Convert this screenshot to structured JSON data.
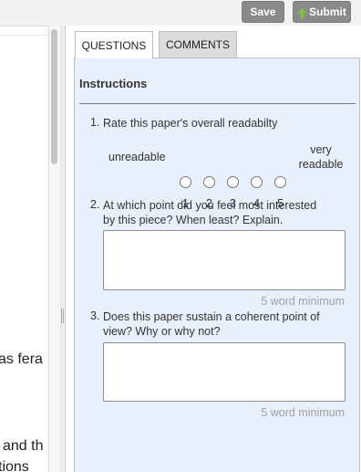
{
  "toolbar": {
    "save_label": "Save",
    "submit_label": "Submit"
  },
  "document": {
    "fragments": [
      "as fera",
      "and th",
      "tions"
    ]
  },
  "tabs": [
    {
      "label": "QUESTIONS",
      "active": true
    },
    {
      "label": "COMMENTS",
      "active": false
    }
  ],
  "instructions": {
    "title": "Instructions"
  },
  "questions": [
    {
      "number": "1.",
      "text": "Rate this paper's overall readabilty",
      "scale": {
        "low_label": "unreadable",
        "high_label_line1": "very",
        "high_label_line2": "readable",
        "options": [
          "1",
          "2",
          "3",
          "4",
          "5"
        ]
      }
    },
    {
      "number": "2.",
      "text_line1": "At which point did you feel most interested",
      "text_line2": "by this piece? When least? Explain.",
      "answer": "",
      "min_note": "5 word minimum"
    },
    {
      "number": "3.",
      "text_line1": "Does this paper sustain a coherent point of",
      "text_line2": "view? Why or why not?",
      "answer": "",
      "min_note": "5 word minimum"
    }
  ],
  "colors": {
    "panel_bg": "#e8f1fb",
    "button_bg": "#8a8a8a",
    "submit_arrow": "#7cc242"
  }
}
